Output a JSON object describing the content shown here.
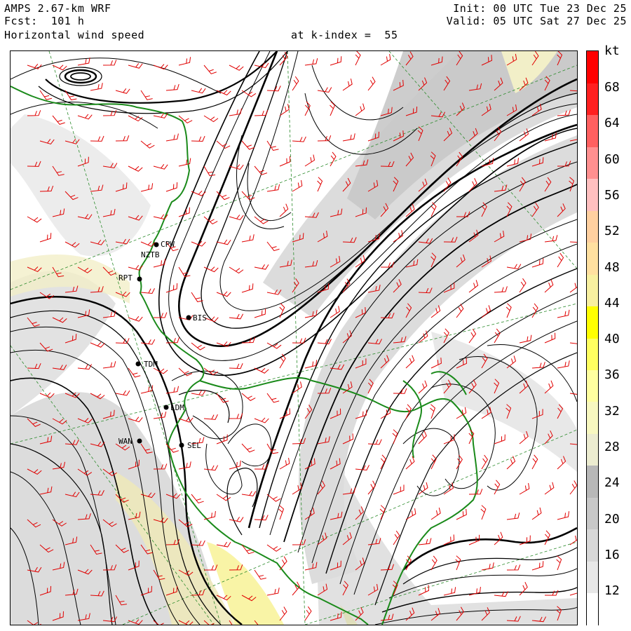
{
  "header": {
    "model": "AMPS 2.67-km WRF",
    "forecast": "Fcst:  101 h",
    "field": "Horizontal wind speed",
    "level": "at k-index =  55",
    "init": "Init: 00 UTC Tue 23 Dec 25",
    "valid": "Valid: 05 UTC Sat 27 Dec 25"
  },
  "colorbar": {
    "unit": "kt",
    "ticks": [
      "68",
      "64",
      "60",
      "56",
      "52",
      "48",
      "44",
      "40",
      "36",
      "32",
      "28",
      "24",
      "20",
      "16",
      "12"
    ],
    "colors": [
      "#ffffff",
      "#e8e8e8",
      "#d8d8d8",
      "#c8c8c8",
      "#b8b8b8",
      "#ececd0",
      "#f8f8c0",
      "#ffffa0",
      "#ffff60",
      "#ffff00",
      "#f8f0a0",
      "#ffe0a0",
      "#ffd0a0",
      "#ffc0c0",
      "#ff9090",
      "#ff6060",
      "#ff2020",
      "#ff0000"
    ]
  },
  "stations": [
    {
      "id": "CPW",
      "label": "CPW"
    },
    {
      "id": "NZTB",
      "label": "NZTB"
    },
    {
      "id": "RPT",
      "label": "RPT"
    },
    {
      "id": "BIS",
      "label": "BIS"
    },
    {
      "id": "TDM",
      "label": "TDM"
    },
    {
      "id": "LDM",
      "label": "LDM"
    },
    {
      "id": "WAN",
      "label": "WAN"
    },
    {
      "id": "SEL",
      "label": "SEL"
    }
  ],
  "colors": {
    "coastline": "#1a8a1a",
    "barbs": "#e00000",
    "grid": "#2a8a2a",
    "streamlines": "#000000"
  }
}
